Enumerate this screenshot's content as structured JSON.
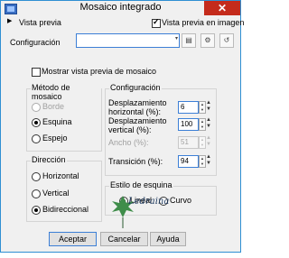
{
  "window": {
    "title": "Mosaico integrado",
    "close_glyph": "✕"
  },
  "preview_row": {
    "label": "Vista previa",
    "checkbox_label": "Vista previa en imagen",
    "checkbox_checked": true
  },
  "config": {
    "label": "Configuración",
    "value": ""
  },
  "toolbar": {
    "arrow_glyph": "▾",
    "save_glyph": "▤",
    "settings_glyph": "⚙",
    "reset_glyph": "↺"
  },
  "mosaic_preview": {
    "label": "Mostrar vista previa de mosaico",
    "checked": false
  },
  "method": {
    "title": "Método de mosaico",
    "options": [
      {
        "label": "Borde",
        "selected": false,
        "disabled": true
      },
      {
        "label": "Esquina",
        "selected": true,
        "disabled": false
      },
      {
        "label": "Espejo",
        "selected": false,
        "disabled": false
      }
    ]
  },
  "direction": {
    "title": "Dirección",
    "options": [
      {
        "label": "Horizontal",
        "selected": false
      },
      {
        "label": "Vertical",
        "selected": false
      },
      {
        "label": "Bidireccional",
        "selected": true
      }
    ]
  },
  "settings": {
    "title": "Configuración",
    "fields": [
      {
        "label": "Desplazamiento horizontal (%):",
        "value": "6",
        "disabled": false
      },
      {
        "label": "Desplazamiento vertical (%):",
        "value": "100",
        "disabled": false
      },
      {
        "label": "Ancho (%):",
        "value": "51",
        "disabled": true
      },
      {
        "label": "Transición (%):",
        "value": "94",
        "disabled": false
      }
    ]
  },
  "corner_style": {
    "title": "Estilo de esquina",
    "options": [
      {
        "label": "Lineal",
        "selected": true
      },
      {
        "label": "Curvo",
        "selected": false
      }
    ]
  },
  "watermark": {
    "text": "Ledraina"
  },
  "buttons": {
    "accept": "Aceptar",
    "cancel": "Cancelar",
    "help": "Ayuda"
  },
  "colors": {
    "accent": "#3c7fd6",
    "close": "#c42b1c",
    "watermark": "#1e3a5f"
  }
}
